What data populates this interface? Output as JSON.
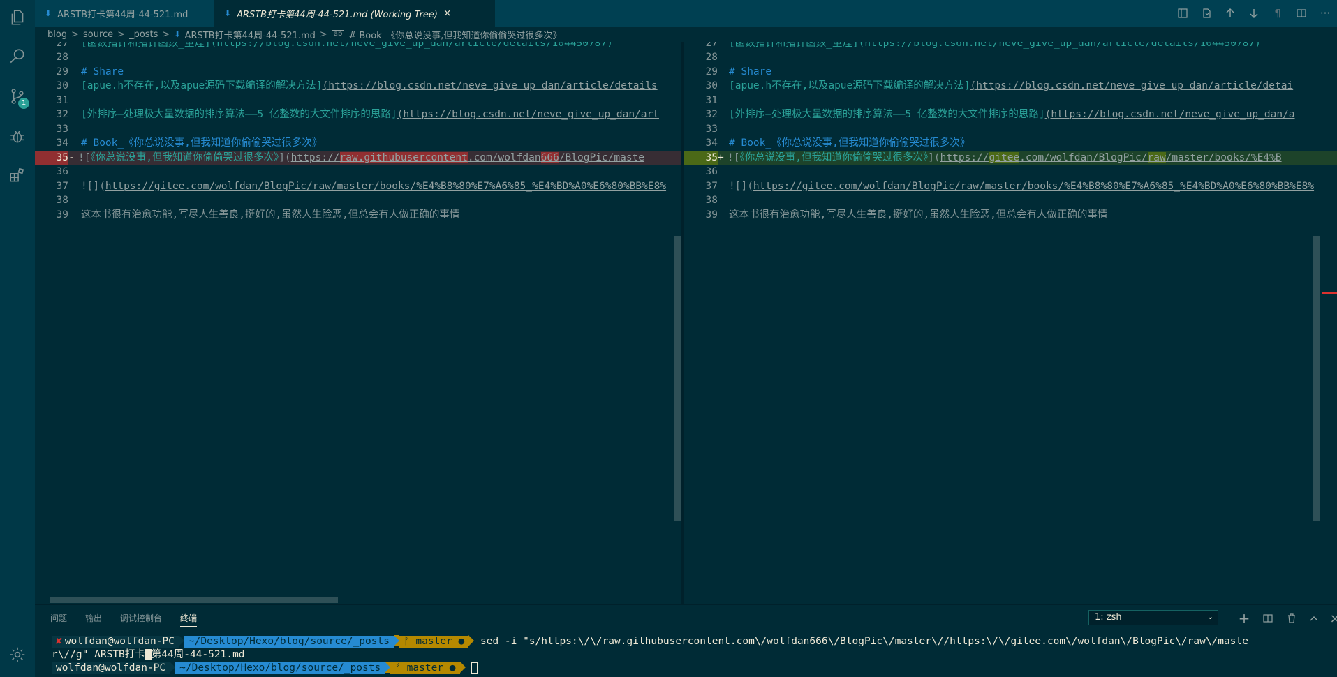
{
  "activity_bar": {
    "icons": [
      "explorer-icon",
      "search-icon",
      "source-control-icon",
      "debug-icon",
      "extensions-icon",
      "gear-icon"
    ],
    "scm_badge": "1"
  },
  "tabs": [
    {
      "label": "ARSTB打卡第44周-44-521.md",
      "active": false
    },
    {
      "label": "ARSTB打卡第44周-44-521.md (Working Tree)",
      "active": true,
      "close": "×"
    }
  ],
  "toolbar": {
    "icons": [
      "open-file-icon",
      "copy-file-icon",
      "arrow-up-icon",
      "arrow-down-icon",
      "pilcrow-icon",
      "split-editor-icon",
      "more-icon"
    ],
    "pilcrow": "¶",
    "more": "···"
  },
  "breadcrumb": {
    "items": [
      "blog",
      "source",
      "_posts",
      "ARSTB打卡第44周-44-521.md",
      "# Book_《你总说没事,但我知道你偷偷哭过很多次》"
    ],
    "separator": ">"
  },
  "left_pane": {
    "lines": [
      {
        "num": "27",
        "text": "[函数指针和指针函数_董煌](https://blog.csdn.net/neve_give_up_dan/article/details/104450787)",
        "kind": "partial"
      },
      {
        "num": "28",
        "text": ""
      },
      {
        "num": "29",
        "text": "# Share",
        "kind": "heading"
      },
      {
        "num": "30",
        "link": "[apue.h不存在,以及apue源码下载编译的解决方法]",
        "url": "(https://blog.csdn.net/neve_give_up_dan/article/details"
      },
      {
        "num": "31",
        "text": ""
      },
      {
        "num": "32",
        "link": "[外排序—处理极大量数据的排序算法——5 亿整数的大文件排序的思路]",
        "url": "(https://blog.csdn.net/neve_give_up_dan/art"
      },
      {
        "num": "33",
        "text": ""
      },
      {
        "num": "34",
        "text": "# Book_《你总说没事,但我知道你偷偷哭过很多次》",
        "kind": "heading"
      },
      {
        "num": "35",
        "sign": "-",
        "prefix": "![",
        "link": "《你总说没事,但我知道你偷偷哭过很多次》",
        "mid": "](",
        "url_a": "https://",
        "url_hl": "raw.githubusercontent",
        "url_b": ".com/wolfdan",
        "url_hl2": "666",
        "url_c": "/BlogPic/maste",
        "kind": "del"
      },
      {
        "num": "36",
        "text": ""
      },
      {
        "num": "37",
        "prefix": "![](",
        "url": "https://gitee.com/wolfdan/BlogPic/raw/master/books/%E4%B8%80%E7%A6%85_%E4%BD%A0%E6%80%BB%E8%"
      },
      {
        "num": "38",
        "text": ""
      },
      {
        "num": "39",
        "text": "这本书很有治愈功能,写尽人生善良,挺好的,虽然人生险恶,但总会有人做正确的事情",
        "kind": "plain"
      }
    ]
  },
  "right_pane": {
    "lines": [
      {
        "num": "27",
        "text": "[函数指针和指针函数_董煌](https://blog.csdn.net/neve_give_up_dan/article/details/104450787)",
        "kind": "partial"
      },
      {
        "num": "28",
        "text": ""
      },
      {
        "num": "29",
        "text": "# Share",
        "kind": "heading"
      },
      {
        "num": "30",
        "link": "[apue.h不存在,以及apue源码下载编译的解决方法]",
        "url": "(https://blog.csdn.net/neve_give_up_dan/article/detai"
      },
      {
        "num": "31",
        "text": ""
      },
      {
        "num": "32",
        "link": "[外排序—处理极大量数据的排序算法——5 亿整数的大文件排序的思路]",
        "url": "(https://blog.csdn.net/neve_give_up_dan/a"
      },
      {
        "num": "33",
        "text": ""
      },
      {
        "num": "34",
        "text": "# Book_《你总说没事,但我知道你偷偷哭过很多次》",
        "kind": "heading"
      },
      {
        "num": "35",
        "sign": "+",
        "prefix": "![",
        "link": "《你总说没事,但我知道你偷偷哭过很多次》",
        "mid": "](",
        "url_a": "https://",
        "url_hl": "gitee",
        "url_b": ".com/wolfdan/BlogPic/",
        "url_hl2": "raw",
        "url_c": "/master/books/%E4%B",
        "kind": "add"
      },
      {
        "num": "36",
        "text": ""
      },
      {
        "num": "37",
        "prefix": "![](",
        "url": "https://gitee.com/wolfdan/BlogPic/raw/master/books/%E4%B8%80%E7%A6%85_%E4%BD%A0%E6%80%BB%E8%"
      },
      {
        "num": "38",
        "text": ""
      },
      {
        "num": "39",
        "text": "这本书很有治愈功能,写尽人生善良,挺好的,虽然人生险恶,但总会有人做正确的事情",
        "kind": "plain"
      }
    ]
  },
  "panel": {
    "tabs": [
      "问题",
      "输出",
      "调试控制台",
      "终端"
    ],
    "active_tab": "终端",
    "terminal_select": "1: zsh",
    "icons": [
      "add-terminal-icon",
      "split-terminal-icon",
      "trash-icon",
      "maximize-icon",
      "close-icon"
    ],
    "add": "+",
    "close": "×"
  },
  "terminal": {
    "status_mark": "✘",
    "user": "wolfdan@wolfdan-PC",
    "path": "~/Desktop/Hexo/blog/source/_posts",
    "branch": "ᚠ master ●",
    "command_line1": "sed -i \"s/https:\\/\\/raw.githubusercontent.com\\/wolfdan666\\/BlogPic\\/master\\//https:\\/\\/gitee.com\\/wolfdan\\/BlogPic\\/raw\\/maste",
    "command_line2_a": "r\\//g\" ARSTB打卡",
    "command_line2_b": "第44周-44-521.md"
  }
}
